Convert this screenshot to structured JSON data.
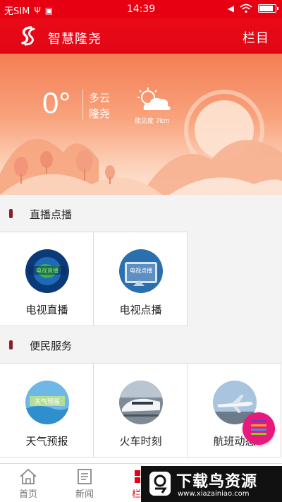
{
  "statusbar": {
    "carrier": "无SIM",
    "time": "14:39"
  },
  "app": {
    "title": "智慧隆尧",
    "menu_label": "栏目",
    "accent": "#e60012"
  },
  "weather": {
    "temperature": "0°",
    "condition": "多云",
    "city": "隆尧",
    "visibility": "能见度 7km"
  },
  "sections": [
    {
      "title": "直播点播",
      "items": [
        {
          "label": "电视直播",
          "icon": "tv-live-icon"
        },
        {
          "label": "电视点播",
          "icon": "tv-vod-icon"
        }
      ]
    },
    {
      "title": "便民服务",
      "items": [
        {
          "label": "天气预报",
          "icon": "weather-forecast-icon"
        },
        {
          "label": "火车时刻",
          "icon": "train-icon"
        },
        {
          "label": "航班动态",
          "icon": "airplane-icon"
        }
      ]
    }
  ],
  "bottom_nav": [
    {
      "label": "首页",
      "icon": "home-icon"
    },
    {
      "label": "新闻",
      "icon": "news-icon"
    },
    {
      "label": "栏目",
      "icon": "columns-icon"
    }
  ],
  "watermark": {
    "title": "下载鸟资源",
    "url": "www.xiazainiao.com"
  }
}
